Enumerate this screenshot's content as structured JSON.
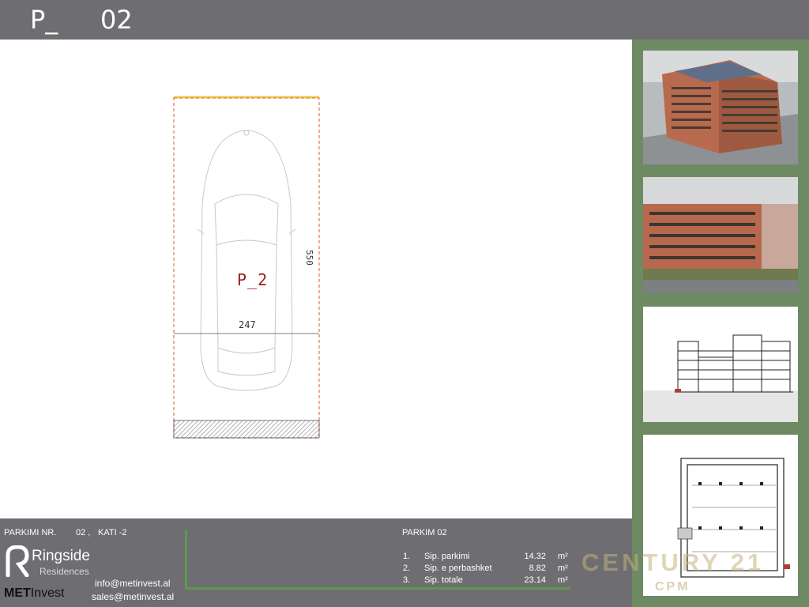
{
  "header": {
    "code_left": "P_",
    "code_right": "02"
  },
  "plan": {
    "spot_label": "P_2",
    "width_dim": "247",
    "length_dim": "550"
  },
  "footer": {
    "parking_label": "PARKIMI NR.",
    "parking_no": "02 ,",
    "floor_label": "KATI -2",
    "brand_name": "Ringside",
    "brand_sub": "Residences",
    "company_a": "MET",
    "company_b": "Invest",
    "email_info": "info@metinvest.al",
    "email_sales": "sales@metinvest.al",
    "table_title": "PARKIM  02",
    "rows": [
      {
        "no": "1.",
        "name": "Sip. parkimi",
        "value": "14.32",
        "unit": "m²"
      },
      {
        "no": "2.",
        "name": "Sip. e perbashket",
        "value": "8.82",
        "unit": "m²"
      },
      {
        "no": "3.",
        "name": "Sip. totale",
        "value": "23.14",
        "unit": "m²"
      }
    ]
  },
  "watermark": {
    "line1": "CENTURY 21",
    "line2": "CPM"
  },
  "colors": {
    "bar": "#6e6d71",
    "frame": "#6e8a63",
    "spot_outline": "#e07a4f",
    "spot_label": "#9b1c1c",
    "accent_line": "#5a9a4d"
  }
}
